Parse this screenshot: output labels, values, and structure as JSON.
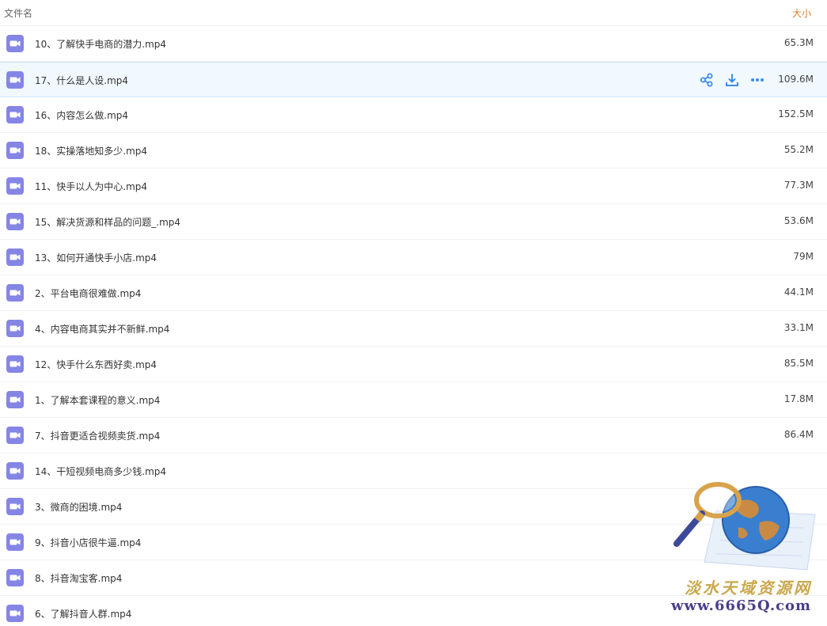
{
  "header": {
    "name_label": "文件名",
    "size_label": "大小"
  },
  "files": [
    {
      "name": "10、了解快手电商的潜力.mp4",
      "size": "65.3M"
    },
    {
      "name": "17、什么是人设.mp4",
      "size": "109.6M",
      "selected": true
    },
    {
      "name": "16、内容怎么做.mp4",
      "size": "152.5M"
    },
    {
      "name": "18、实操落地知多少.mp4",
      "size": "55.2M"
    },
    {
      "name": "11、快手以人为中心.mp4",
      "size": "77.3M"
    },
    {
      "name": "15、解决货源和样品的问题_.mp4",
      "size": "53.6M"
    },
    {
      "name": "13、如何开通快手小店.mp4",
      "size": "79M"
    },
    {
      "name": "2、平台电商很难做.mp4",
      "size": "44.1M"
    },
    {
      "name": "4、内容电商其实并不新鲜.mp4",
      "size": "33.1M"
    },
    {
      "name": "12、快手什么东西好卖.mp4",
      "size": "85.5M"
    },
    {
      "name": "1、了解本套课程的意义.mp4",
      "size": "17.8M"
    },
    {
      "name": "7、抖音更适合视频卖货.mp4",
      "size": "86.4M"
    },
    {
      "name": "14、干短视频电商多少钱.mp4",
      "size": ""
    },
    {
      "name": "3、微商的困境.mp4",
      "size": ""
    },
    {
      "name": "9、抖音小店很牛逼.mp4",
      "size": ""
    },
    {
      "name": "8、抖音淘宝客.mp4",
      "size": ""
    },
    {
      "name": "6、了解抖音人群.mp4",
      "size": ""
    }
  ],
  "row_actions": [
    "share-icon",
    "download-icon",
    "more-icon"
  ],
  "watermark": {
    "title": "淡水天域资源网",
    "url": "www.6665Q.com"
  },
  "colors": {
    "icon": "#8585e6",
    "action": "#3b8ee6",
    "size_header": "#e07a2a",
    "selected_bg": "#f1f8fe"
  }
}
